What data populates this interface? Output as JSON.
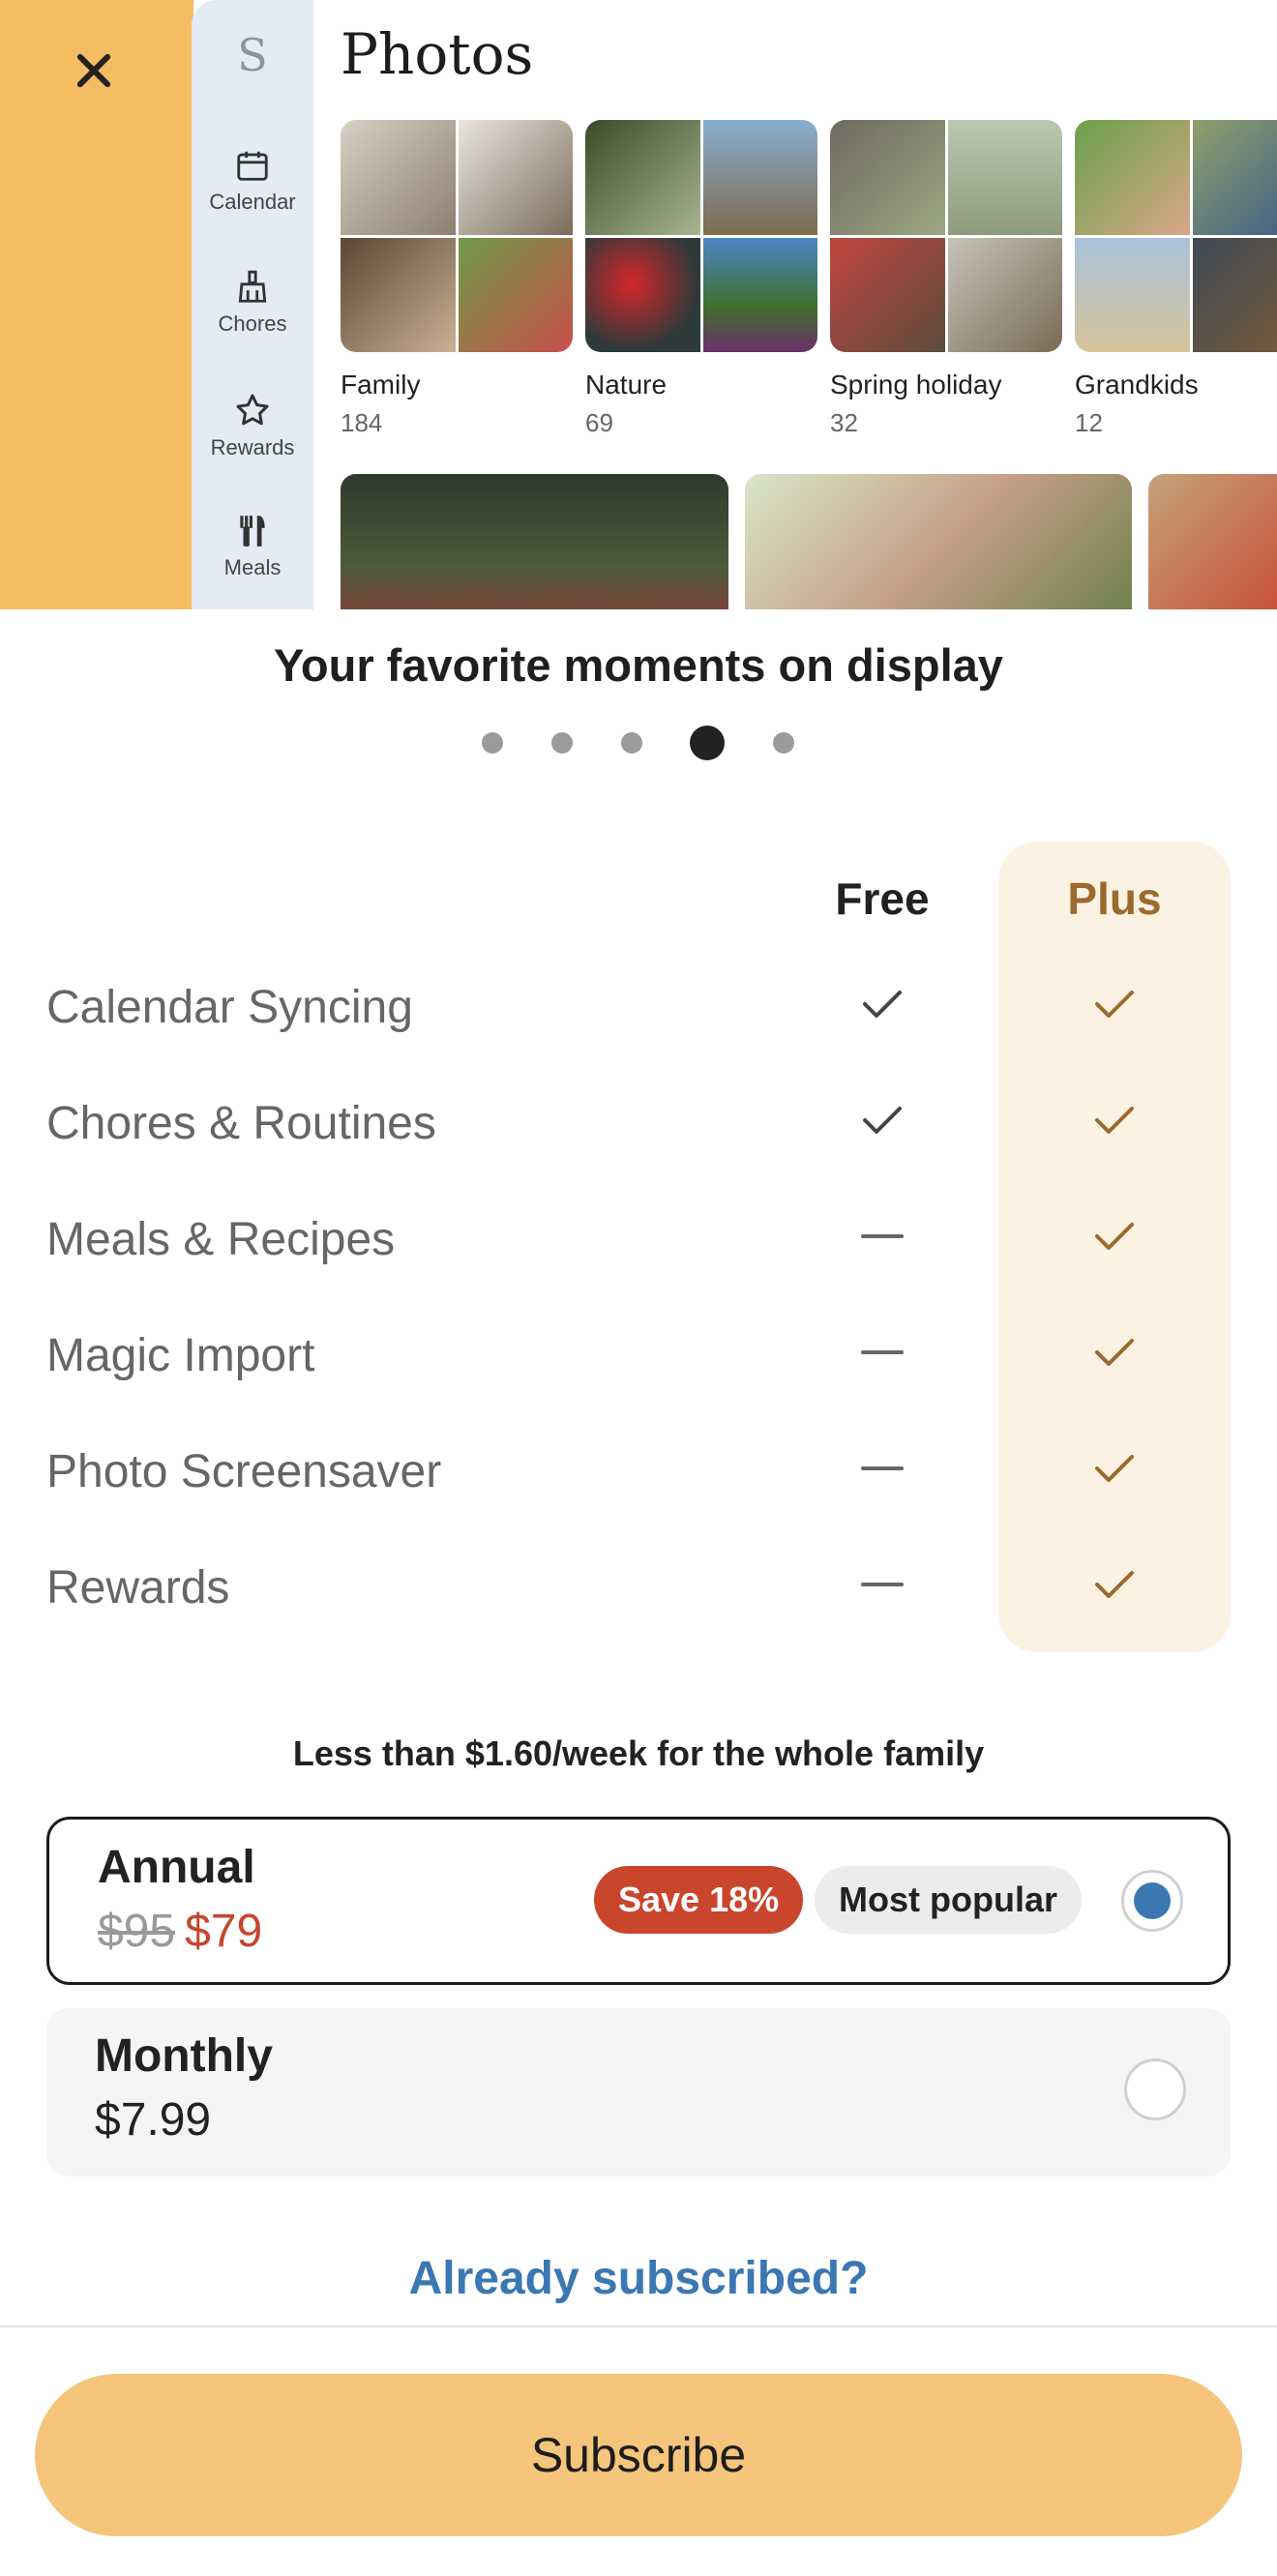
{
  "preview": {
    "sidebar_initial": "S",
    "sidebar_items": [
      {
        "label": "Calendar",
        "icon": "calendar-icon"
      },
      {
        "label": "Chores",
        "icon": "broom-icon"
      },
      {
        "label": "Rewards",
        "icon": "star-icon"
      },
      {
        "label": "Meals",
        "icon": "utensils-icon"
      }
    ],
    "title": "Photos",
    "albums": [
      {
        "name": "Family",
        "count": "184"
      },
      {
        "name": "Nature",
        "count": "69"
      },
      {
        "name": "Spring holiday",
        "count": "32"
      },
      {
        "name": "Grandkids",
        "count": "12"
      }
    ]
  },
  "headline": "Your favorite moments on display",
  "carousel": {
    "total": 5,
    "active_index": 3
  },
  "comparison": {
    "free_header": "Free",
    "plus_header": "Plus",
    "features": [
      {
        "label": "Calendar Syncing",
        "free": "check",
        "plus": "check"
      },
      {
        "label": "Chores & Routines",
        "free": "check",
        "plus": "check"
      },
      {
        "label": "Meals & Recipes",
        "free": "dash",
        "plus": "check"
      },
      {
        "label": "Magic Import",
        "free": "dash",
        "plus": "check"
      },
      {
        "label": "Photo Screensaver",
        "free": "dash",
        "plus": "check"
      },
      {
        "label": "Rewards",
        "free": "dash",
        "plus": "check"
      }
    ]
  },
  "pricing": {
    "note": "Less than $1.60/week for the whole family",
    "annual": {
      "name": "Annual",
      "old_price": "$95",
      "price": "$79",
      "save_badge": "Save 18%",
      "popular_badge": "Most popular",
      "selected": true
    },
    "monthly": {
      "name": "Monthly",
      "price": "$7.99",
      "selected": false
    }
  },
  "already_subscribed": "Already subscribed?",
  "subscribe_label": "Subscribe",
  "colors": {
    "accent_orange": "#f5bd62",
    "plus_brown": "#9b6a2f",
    "plus_bg": "#fcf2e3",
    "save_red": "#c9452c",
    "link_blue": "#3a77b3",
    "button_bg": "#f4c57a"
  }
}
